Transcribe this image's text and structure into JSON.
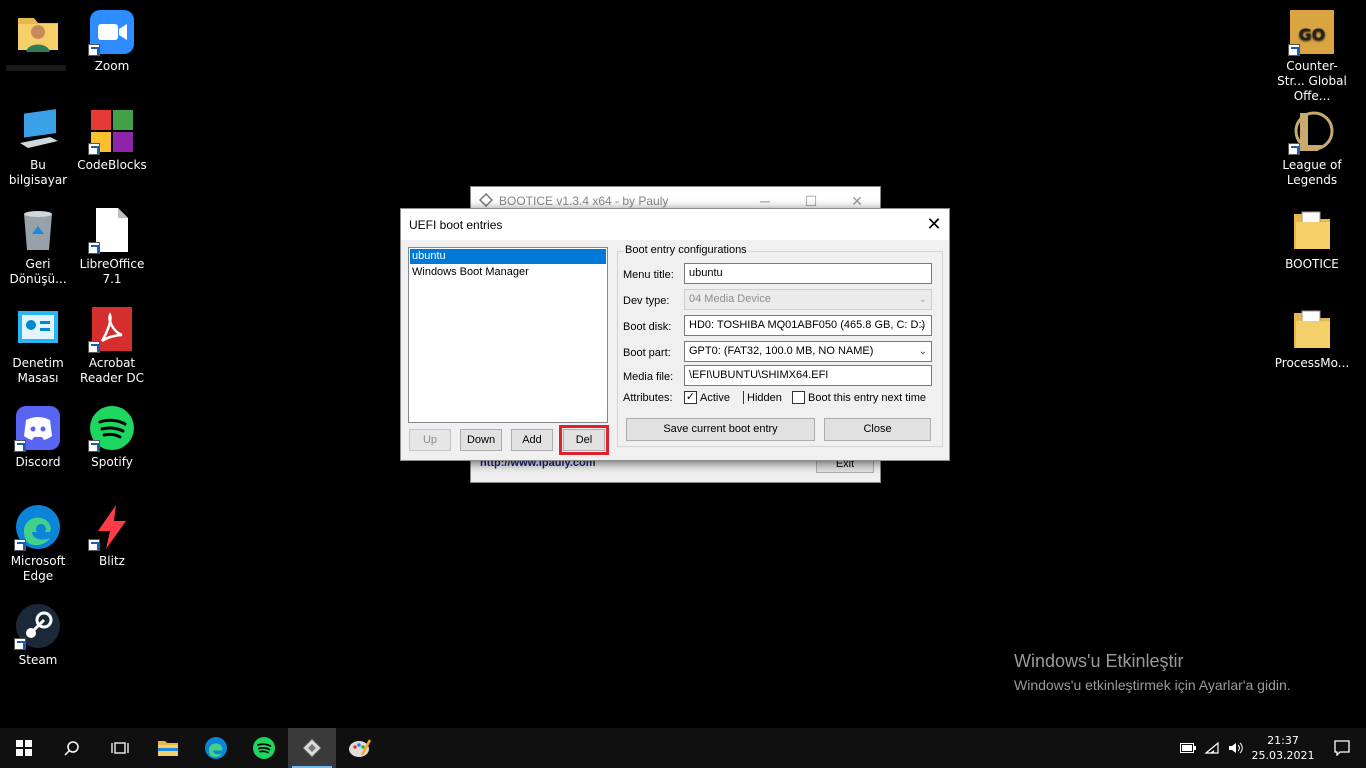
{
  "desktop": {
    "left_icons": [
      {
        "label": "",
        "icon": "user-folder-icon"
      },
      {
        "label": "Zoom",
        "icon": "zoom-icon"
      },
      {
        "label": "Bu bilgisayar",
        "icon": "computer-icon"
      },
      {
        "label": "CodeBlocks",
        "icon": "codeblocks-icon"
      },
      {
        "label": "Geri Dönüşü...",
        "icon": "recycle-bin-icon"
      },
      {
        "label": "LibreOffice 7.1",
        "icon": "libreoffice-icon"
      },
      {
        "label": "Denetim Masası",
        "icon": "control-panel-icon"
      },
      {
        "label": "Acrobat Reader DC",
        "icon": "acrobat-icon"
      },
      {
        "label": "Discord",
        "icon": "discord-icon"
      },
      {
        "label": "Spotify",
        "icon": "spotify-icon"
      },
      {
        "label": "Microsoft Edge",
        "icon": "edge-icon"
      },
      {
        "label": "Blitz",
        "icon": "blitz-icon"
      },
      {
        "label": "Steam",
        "icon": "steam-icon"
      }
    ],
    "right_icons": [
      {
        "label": "Counter-Str... Global Offe...",
        "icon": "csgo-icon"
      },
      {
        "label": "League of Legends",
        "icon": "league-icon"
      },
      {
        "label": "BOOTICE",
        "icon": "bootice-folder-icon"
      },
      {
        "label": "ProcessMo...",
        "icon": "folder-icon"
      }
    ]
  },
  "watermark": {
    "title": "Windows'u Etkinleştir",
    "subtitle": "Windows'u etkinleştirmek için Ayarlar'a gidin."
  },
  "bg_window": {
    "title": "BOOTICE v1.3.4 x64 - by Pauly",
    "url": "http://www.ipauly.com",
    "exit_label": "Exit"
  },
  "dialog": {
    "title": "UEFI boot entries",
    "entries": [
      "ubuntu",
      "Windows Boot Manager"
    ],
    "selected_index": 0,
    "buttons": {
      "up": "Up",
      "down": "Down",
      "add": "Add",
      "del": "Del"
    },
    "group_label": "Boot entry configurations",
    "labels": {
      "menu_title": "Menu title:",
      "dev_type": "Dev type:",
      "boot_disk": "Boot disk:",
      "boot_part": "Boot part:",
      "media_file": "Media file:",
      "attributes": "Attributes:"
    },
    "values": {
      "menu_title": "ubuntu",
      "dev_type": "04  Media Device",
      "boot_disk": "HD0: TOSHIBA MQ01ABF050 (465.8 GB, C: D:)",
      "boot_part": "GPT0: (FAT32, 100.0 MB, NO NAME)",
      "media_file": "\\EFI\\UBUNTU\\SHIMX64.EFI"
    },
    "attributes": {
      "active": {
        "label": "Active",
        "checked": true
      },
      "hidden": {
        "label": "Hidden",
        "checked": false
      },
      "boot_next": {
        "label": "Boot this entry next time",
        "checked": false
      }
    },
    "save_label": "Save current boot entry",
    "close_label": "Close"
  },
  "taskbar": {
    "time": "21:37",
    "date": "25.03.2021"
  },
  "colors": {
    "selection": "#0078d7",
    "highlight": "#e0202a"
  }
}
